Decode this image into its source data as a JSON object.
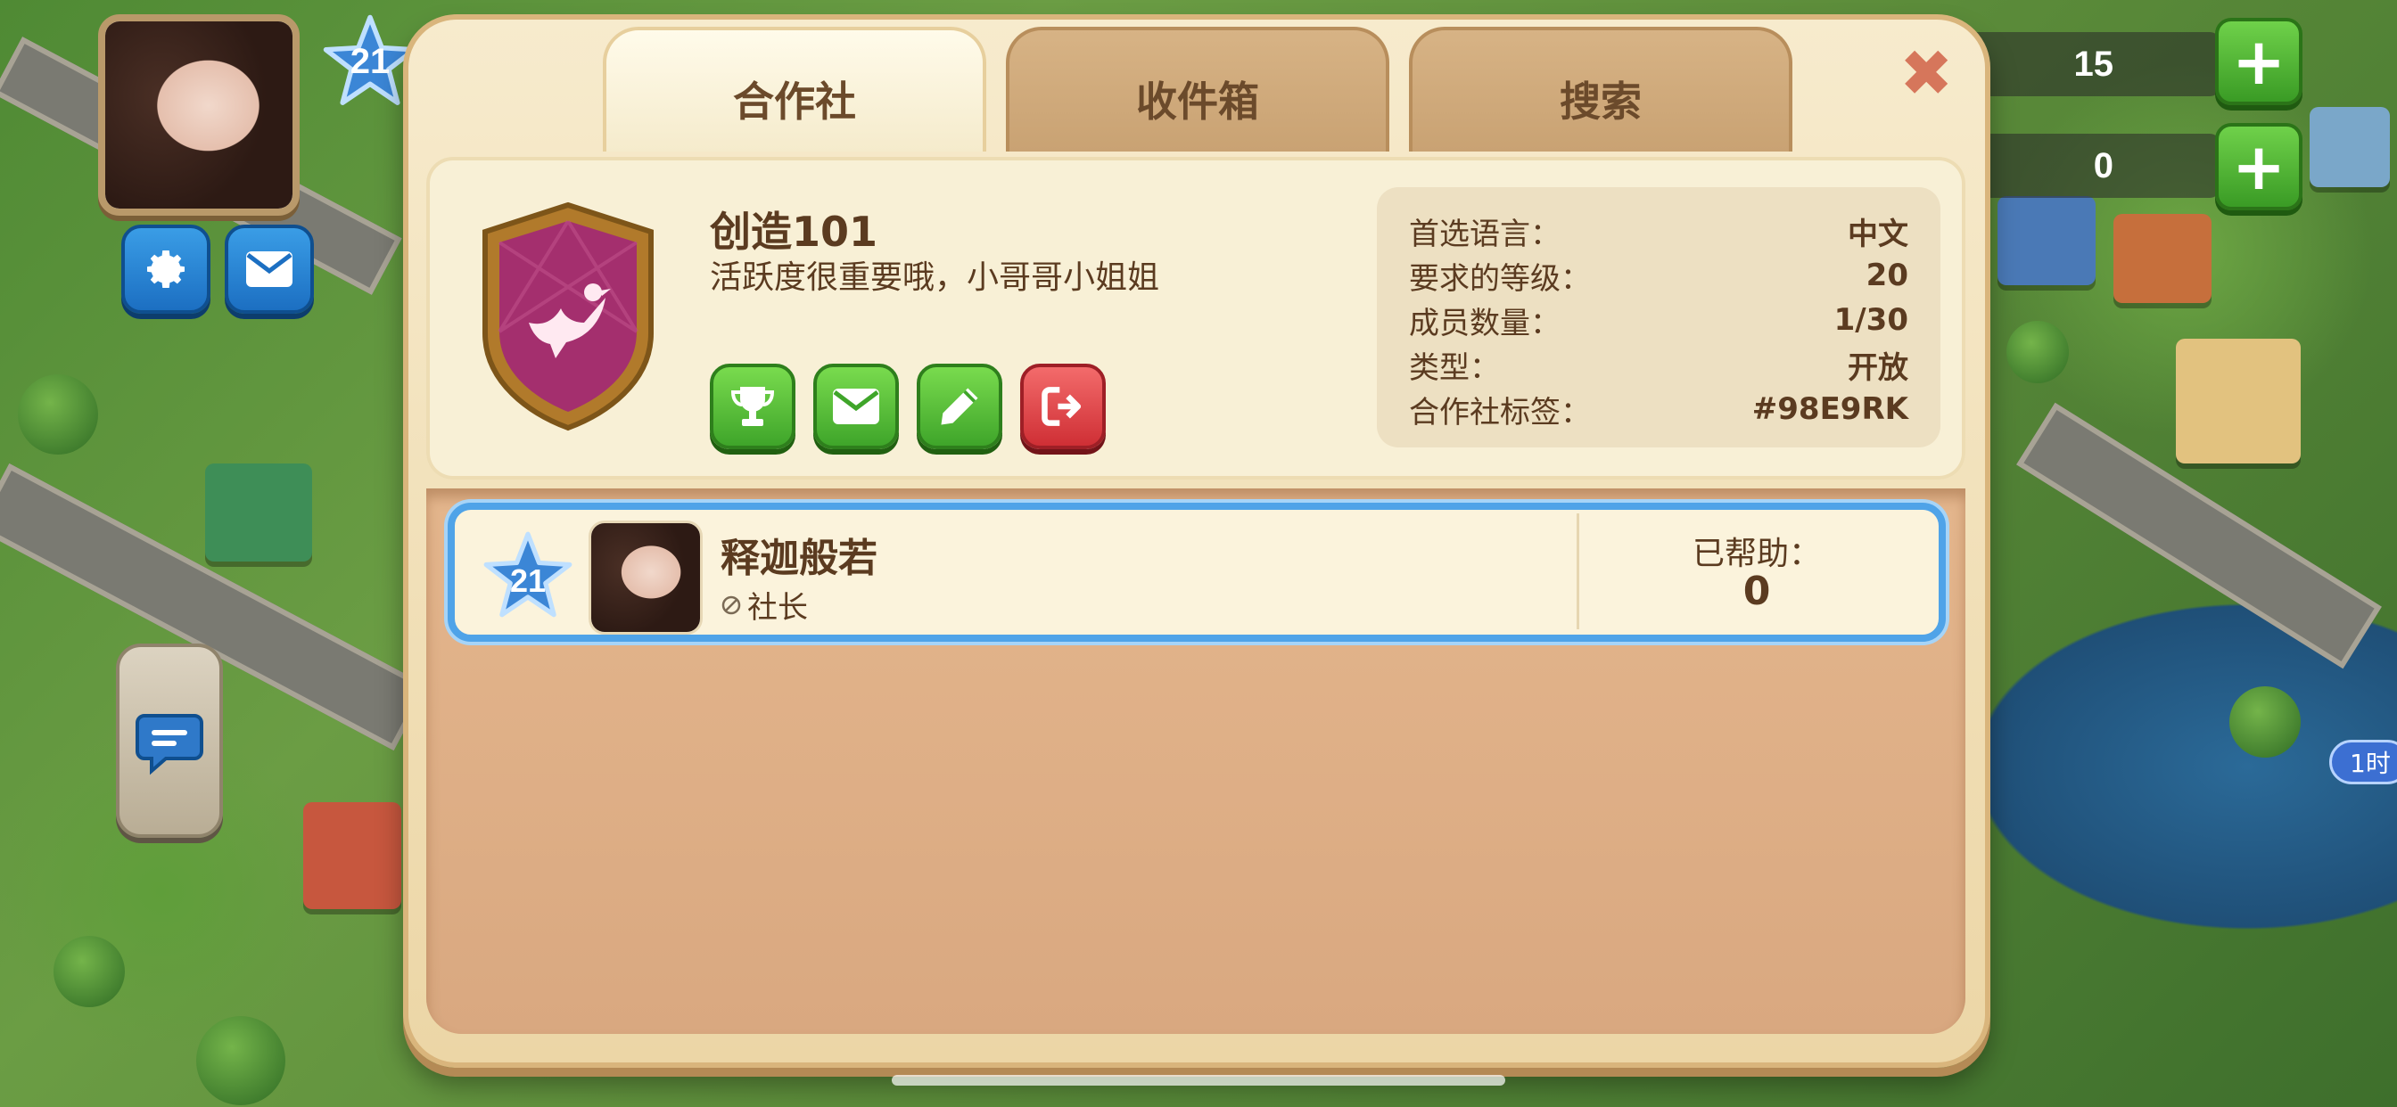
{
  "hud": {
    "player_level": "21",
    "counter_top": "15",
    "counter_second": "0",
    "side_timer": "1时"
  },
  "tabs": [
    {
      "label": "合作社",
      "active": true
    },
    {
      "label": "收件箱",
      "active": false
    },
    {
      "label": "搜索",
      "active": false
    }
  ],
  "close_symbol": "✖",
  "club": {
    "name": "创造101",
    "description": "活跃度很重要哦，小哥哥小姐姐",
    "badge_icon": "dove-icon",
    "badge_color": "#a42f6e",
    "actions": [
      {
        "name": "trophy",
        "icon": "trophy-icon",
        "color": "green"
      },
      {
        "name": "mail",
        "icon": "mail-icon",
        "color": "green"
      },
      {
        "name": "edit",
        "icon": "pencil-icon",
        "color": "green"
      },
      {
        "name": "leave",
        "icon": "exit-icon",
        "color": "red"
      }
    ],
    "meta": [
      {
        "label": "首选语言：",
        "value": "中文"
      },
      {
        "label": "要求的等级：",
        "value": "20"
      },
      {
        "label": "成员数量：",
        "value": "1/30"
      },
      {
        "label": "类型：",
        "value": "开放"
      },
      {
        "label": "合作社标签：",
        "value": "#98E9RK"
      }
    ]
  },
  "members": [
    {
      "level": "21",
      "name": "释迦般若",
      "role": "社长",
      "helped_label": "已帮助：",
      "helped_value": "0"
    }
  ],
  "colors": {
    "accent_blue": "#4fa3e8",
    "button_green": "#3fa52a",
    "button_red": "#cf2f35",
    "text_brown": "#5b3b20"
  }
}
